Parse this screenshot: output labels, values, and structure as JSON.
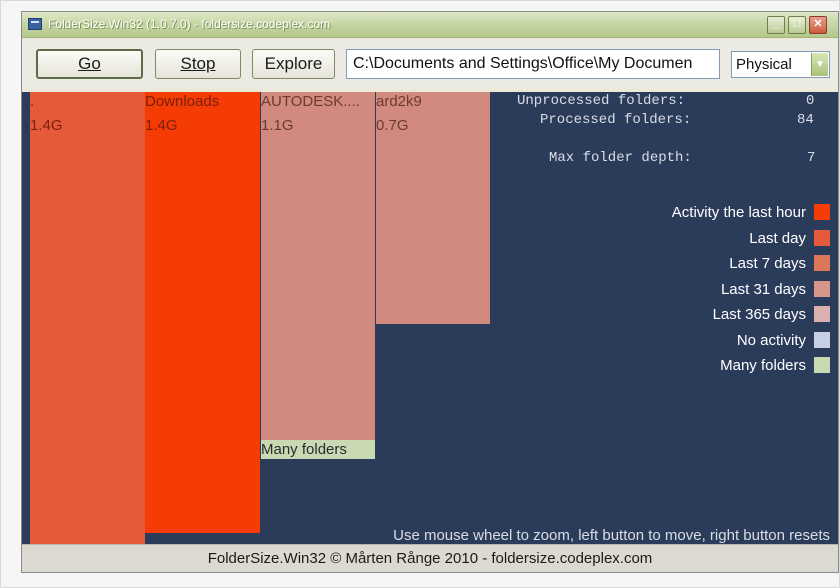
{
  "window": {
    "title": "FolderSize.Win32 (1.0.7.0) - foldersize.codeplex.com",
    "controls": {
      "minimize": "_",
      "maximize": "□",
      "close": "✕"
    }
  },
  "toolbar": {
    "go_label": "Go",
    "stop_label": "Stop",
    "explore_label": "Explore",
    "path_value": "C:\\Documents and Settings\\Office\\My Documen",
    "mode_selected": "Physical"
  },
  "treemap": {
    "blocks": [
      {
        "name": ".",
        "size": "1.4G",
        "color": "#e55b3a",
        "label_color": "#7a1f0a"
      },
      {
        "name": "Downloads",
        "size": "1.4G",
        "color": "#f43c04",
        "label_color": "#7a1f0a"
      },
      {
        "name": "AUTODESK....",
        "size": "1.1G",
        "color": "#d28a7e",
        "label_color": "#6d3a30"
      },
      {
        "name": "ard2k9",
        "size": "0.7G",
        "color": "#d28a7e",
        "label_color": "#6d3a30"
      },
      {
        "name": "Many folders",
        "size": "",
        "color": "#c9d9b4",
        "label_color": "#2a2a2a"
      }
    ]
  },
  "stats": {
    "unprocessed_label": "Unprocessed folders:",
    "unprocessed_value": "0",
    "processed_label": "Processed folders:",
    "processed_value": "84",
    "depth_label": "Max folder depth:",
    "depth_value": "7"
  },
  "legend": [
    {
      "label": "Activity the last hour",
      "color": "#f43c04"
    },
    {
      "label": "Last day",
      "color": "#e55b3a"
    },
    {
      "label": "Last 7 days",
      "color": "#dc7658"
    },
    {
      "label": "Last 31 days",
      "color": "#d8958b"
    },
    {
      "label": "Last 365 days",
      "color": "#dab1ae"
    },
    {
      "label": "No activity",
      "color": "#c5d0e4"
    },
    {
      "label": "Many folders",
      "color": "#c9d9b4"
    }
  ],
  "hint": "Use mouse wheel to zoom, left button to move, right button resets",
  "status": "FolderSize.Win32 © Mårten Rånge 2010 - foldersize.codeplex.com"
}
